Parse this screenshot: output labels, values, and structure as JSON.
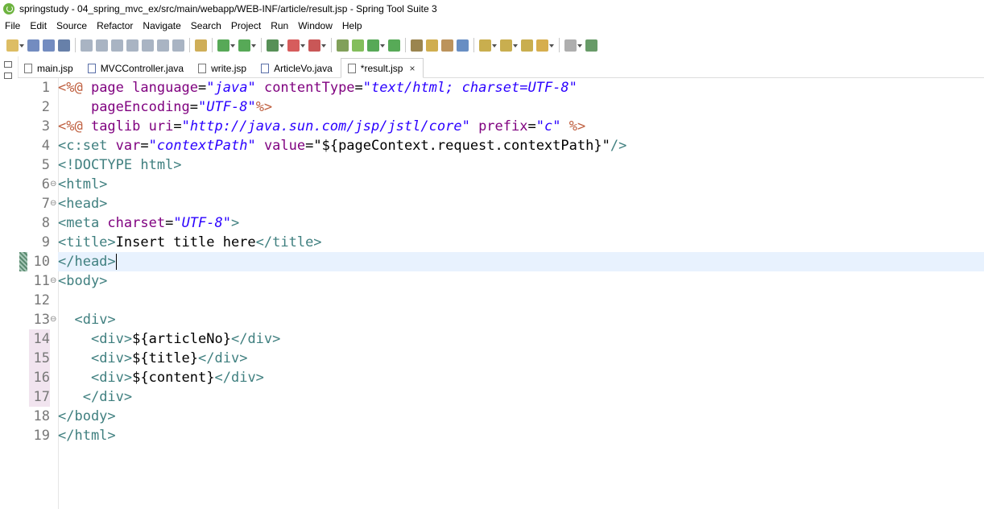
{
  "window": {
    "title": "springstudy - 04_spring_mvc_ex/src/main/webapp/WEB-INF/article/result.jsp - Spring Tool Suite 3"
  },
  "menu": [
    "File",
    "Edit",
    "Source",
    "Refactor",
    "Navigate",
    "Search",
    "Project",
    "Run",
    "Window",
    "Help"
  ],
  "tabs": [
    {
      "label": "main.jsp",
      "kind": "jsp"
    },
    {
      "label": "MVCController.java",
      "kind": "java"
    },
    {
      "label": "write.jsp",
      "kind": "jsp"
    },
    {
      "label": "ArticleVo.java",
      "kind": "java"
    },
    {
      "label": "*result.jsp",
      "kind": "jsp",
      "active": true
    }
  ],
  "close_glyph": "×",
  "colors": {
    "tag": "#3f7f7f",
    "attr": "#7f007f",
    "value": "#2a00ff",
    "directive": "#bf5f3f",
    "current_line": "#e8f2fe"
  },
  "code": [
    {
      "n": "1",
      "fold": "",
      "tokens": [
        [
          "dir",
          "<%@ "
        ],
        [
          "attr",
          "page "
        ],
        [
          "attr",
          "language"
        ],
        [
          "txt",
          "="
        ],
        [
          "val",
          "\"java\""
        ],
        [
          "txt",
          " "
        ],
        [
          "attr",
          "contentType"
        ],
        [
          "txt",
          "="
        ],
        [
          "val",
          "\"text/html; charset=UTF-8\""
        ]
      ]
    },
    {
      "n": "2",
      "fold": "",
      "tokens": [
        [
          "txt",
          "    "
        ],
        [
          "attr",
          "pageEncoding"
        ],
        [
          "txt",
          "="
        ],
        [
          "val",
          "\"UTF-8\""
        ],
        [
          "dir",
          "%>"
        ]
      ]
    },
    {
      "n": "3",
      "fold": "",
      "tokens": [
        [
          "dir",
          "<%@ "
        ],
        [
          "attr",
          "taglib "
        ],
        [
          "attr",
          "uri"
        ],
        [
          "txt",
          "="
        ],
        [
          "val",
          "\"http://java.sun.com/jsp/jstl/core\""
        ],
        [
          "txt",
          " "
        ],
        [
          "attr",
          "prefix"
        ],
        [
          "txt",
          "="
        ],
        [
          "val",
          "\"c\""
        ],
        [
          "txt",
          " "
        ],
        [
          "dir",
          "%>"
        ]
      ]
    },
    {
      "n": "4",
      "fold": "",
      "tokens": [
        [
          "tag",
          "<c:set "
        ],
        [
          "attr",
          "var"
        ],
        [
          "txt",
          "="
        ],
        [
          "val",
          "\"contextPath\""
        ],
        [
          "txt",
          " "
        ],
        [
          "attr",
          "value"
        ],
        [
          "txt",
          "=\"${pageContext.request.contextPath}\""
        ],
        [
          "tag",
          "/>"
        ]
      ]
    },
    {
      "n": "5",
      "fold": "",
      "tokens": [
        [
          "tag",
          "<!DOCTYPE html>"
        ]
      ]
    },
    {
      "n": "6",
      "fold": "⊖",
      "tokens": [
        [
          "tag",
          "<html>"
        ]
      ]
    },
    {
      "n": "7",
      "fold": "⊖",
      "tokens": [
        [
          "tag",
          "<head>"
        ]
      ]
    },
    {
      "n": "8",
      "fold": "",
      "tokens": [
        [
          "tag",
          "<meta "
        ],
        [
          "attr",
          "charset"
        ],
        [
          "txt",
          "="
        ],
        [
          "val",
          "\"UTF-8\""
        ],
        [
          "tag",
          ">"
        ]
      ]
    },
    {
      "n": "9",
      "fold": "",
      "tokens": [
        [
          "tag",
          "<title>"
        ],
        [
          "txt",
          "Insert title here"
        ],
        [
          "tag",
          "</title>"
        ]
      ]
    },
    {
      "n": "10",
      "fold": "",
      "tokens": [
        [
          "tag",
          "</head>"
        ]
      ],
      "current": true
    },
    {
      "n": "11",
      "fold": "⊖",
      "tokens": [
        [
          "tag",
          "<body>"
        ]
      ]
    },
    {
      "n": "12",
      "fold": "",
      "tokens": []
    },
    {
      "n": "13",
      "fold": "⊖",
      "tokens": [
        [
          "txt",
          "  "
        ],
        [
          "tag",
          "<div>"
        ]
      ]
    },
    {
      "n": "14",
      "fold": "",
      "tokens": [
        [
          "txt",
          "    "
        ],
        [
          "tag",
          "<div>"
        ],
        [
          "txt",
          "${articleNo}"
        ],
        [
          "tag",
          "</div>"
        ]
      ],
      "mark": true
    },
    {
      "n": "15",
      "fold": "",
      "tokens": [
        [
          "txt",
          "    "
        ],
        [
          "tag",
          "<div>"
        ],
        [
          "txt",
          "${title}"
        ],
        [
          "tag",
          "</div>"
        ]
      ],
      "mark": true
    },
    {
      "n": "16",
      "fold": "",
      "tokens": [
        [
          "txt",
          "    "
        ],
        [
          "tag",
          "<div>"
        ],
        [
          "txt",
          "${content}"
        ],
        [
          "tag",
          "</div>"
        ]
      ],
      "mark": true
    },
    {
      "n": "17",
      "fold": "",
      "tokens": [
        [
          "txt",
          "   "
        ],
        [
          "tag",
          "</div>"
        ]
      ],
      "mark": true
    },
    {
      "n": "18",
      "fold": "",
      "tokens": [
        [
          "tag",
          "</body>"
        ]
      ]
    },
    {
      "n": "19",
      "fold": "",
      "tokens": [
        [
          "tag",
          "</html>"
        ]
      ]
    }
  ],
  "toolbar_icons": [
    "new-icon",
    "save-icon",
    "save-all-icon",
    "print-icon",
    "skip-icon",
    "resume-icon",
    "suspend-icon",
    "terminate-icon",
    "step-into-icon",
    "step-over-icon",
    "step-return-icon",
    "open-console-icon",
    "debug-icon",
    "run-icon",
    "coverage-icon",
    "stop-icon",
    "external-tools-icon",
    "open-task-icon",
    "new-spring-icon",
    "boot-dashboard-icon",
    "refresh-icon",
    "open-type-icon",
    "open-file-icon",
    "search-icon",
    "globe-icon",
    "next-annotation-icon",
    "prev-annotation-icon",
    "last-edit-icon",
    "back-icon",
    "forward-icon",
    "pin-icon"
  ]
}
